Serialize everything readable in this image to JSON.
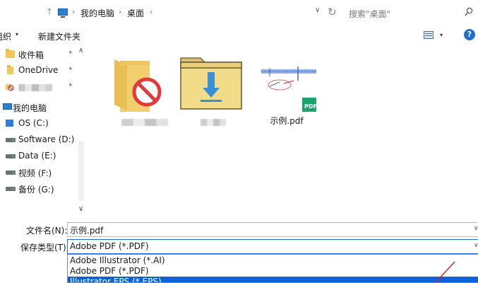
{
  "address": {
    "back_glyph": "←",
    "forward_glyph": "→",
    "up_glyph": "↑",
    "breadcrumb": [
      "我的电脑",
      "桌面"
    ],
    "separator": "›",
    "dropdown_glyph": "∨",
    "refresh_glyph": "↻",
    "search_placeholder": "搜索\"桌面\""
  },
  "toolbar": {
    "organize_label": "组织",
    "organize_arrow": "▾",
    "new_folder_label": "新建文件夹",
    "view_arrow": "▾",
    "help_label": "?"
  },
  "sidebar": {
    "scroll_up": "∧",
    "scroll_down": "∨",
    "pin_glyph": "✦",
    "items": [
      {
        "label": "收件箱",
        "icon": "folder-icon",
        "pinned": true
      },
      {
        "label": "OneDrive",
        "icon": "folder-icon",
        "pinned": true
      },
      {
        "label": "",
        "icon": "blocked-icon",
        "pinned": true
      },
      {
        "label": "我的电脑",
        "icon": "computer-icon",
        "pinned": false
      },
      {
        "label": "OS (C:)",
        "icon": "os-drive-icon",
        "pinned": false
      },
      {
        "label": "Software (D:)",
        "icon": "drive-icon",
        "pinned": false
      },
      {
        "label": "Data (E:)",
        "icon": "drive-icon",
        "pinned": false
      },
      {
        "label": "视频 (F:)",
        "icon": "drive-icon",
        "pinned": false
      },
      {
        "label": "备份 (G:)",
        "icon": "drive-icon",
        "pinned": false
      }
    ]
  },
  "files": [
    {
      "name": "",
      "icon": "blocked-folder-icon"
    },
    {
      "name": "",
      "icon": "download-folder-icon"
    },
    {
      "name": "示例.pdf",
      "icon": "pdf-file-icon",
      "badge": "PDF"
    }
  ],
  "form": {
    "filename_label": "文件名(N):",
    "filename_value": "示例.pdf",
    "filetype_label": "保存类型(T):",
    "filetype_value": "Adobe PDF (*.PDF)",
    "dropdown_glyph": "∨",
    "type_options": [
      "Adobe Illustrator (*.AI)",
      "Adobe PDF (*.PDF)",
      "Illustrator EPS (*.EPS)"
    ],
    "selected_option_index": 2
  },
  "colors": {
    "accent": "#0a64d6",
    "folder": "#f0c95a",
    "pdf_badge": "#1aa36f",
    "annotation": "#d22a2a"
  }
}
